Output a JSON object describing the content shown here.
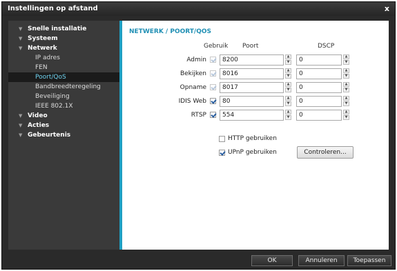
{
  "window": {
    "title": "Instellingen op afstand",
    "close_label": "x"
  },
  "sidebar": {
    "items": [
      {
        "label": "Snelle installatie",
        "type": "category"
      },
      {
        "label": "Systeem",
        "type": "category"
      },
      {
        "label": "Netwerk",
        "type": "category"
      },
      {
        "label": "IP adres",
        "type": "sub"
      },
      {
        "label": "FEN",
        "type": "sub"
      },
      {
        "label": "Poort/QoS",
        "type": "sub",
        "active": true
      },
      {
        "label": "Bandbreedteregeling",
        "type": "sub"
      },
      {
        "label": "Beveiliging",
        "type": "sub"
      },
      {
        "label": "IEEE 802.1X",
        "type": "sub"
      },
      {
        "label": "Video",
        "type": "category"
      },
      {
        "label": "Acties",
        "type": "category"
      },
      {
        "label": "Gebeurtenis",
        "type": "category"
      }
    ]
  },
  "main": {
    "heading": "NETWERK / POORT/QOS",
    "columns": {
      "use": "Gebruik",
      "port": "Poort",
      "dscp": "DSCP"
    },
    "rows": [
      {
        "label": "Admin",
        "checked": true,
        "disabled": true,
        "port": "8200",
        "dscp": "0"
      },
      {
        "label": "Bekijken",
        "checked": true,
        "disabled": true,
        "port": "8016",
        "dscp": "0"
      },
      {
        "label": "Opname",
        "checked": true,
        "disabled": true,
        "port": "8017",
        "dscp": "0"
      },
      {
        "label": "IDIS Web",
        "checked": true,
        "disabled": false,
        "port": "80",
        "dscp": "0"
      },
      {
        "label": "RTSP",
        "checked": true,
        "disabled": false,
        "port": "554",
        "dscp": "0"
      }
    ],
    "http_label": "HTTP gebruiken",
    "http_checked": false,
    "upnp_label": "UPnP gebruiken",
    "upnp_checked": true,
    "check_button": "Controleren..."
  },
  "footer": {
    "ok": "OK",
    "cancel": "Annuleren",
    "apply": "Toepassen"
  },
  "colors": {
    "accent": "#1f9fc2",
    "heading": "#1f8fb4",
    "active_item": "#6fd3f0"
  }
}
